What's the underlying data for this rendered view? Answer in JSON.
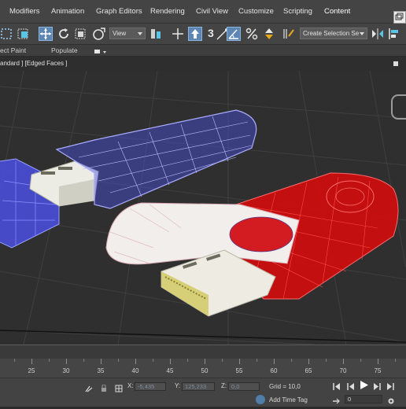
{
  "menubar": {
    "items": [
      "Modifiers",
      "Animation",
      "Graph Editors",
      "Rendering",
      "Civil View",
      "Customize",
      "Scripting",
      "Content"
    ]
  },
  "toolbar": {
    "view_dropdown": "View",
    "snap_label": "3",
    "selection_set": "Create Selection Se"
  },
  "ribbon": {
    "items": [
      "ect Paint",
      "Populate"
    ]
  },
  "viewport": {
    "label": "andard ] [Edged Faces ]"
  },
  "timeline": {
    "ticks": [
      "25",
      "30",
      "35",
      "40",
      "45",
      "50",
      "55",
      "60",
      "65",
      "70",
      "75"
    ]
  },
  "status": {
    "x_label": "X:",
    "x_value": "-5,435",
    "y_label": "Y:",
    "y_value": "125,233",
    "z_label": "Z:",
    "z_value": "0,0",
    "grid": "Grid = 10,0",
    "add_time_tag": "Add Time Tag",
    "frame_value": "0"
  },
  "colors": {
    "menubar_bg": "#444444",
    "viewport_bg": "#2f2f2f",
    "drive_blue": "#4a4fe0",
    "drive_red": "#d40c0c",
    "active_tool": "#5d86b4"
  }
}
